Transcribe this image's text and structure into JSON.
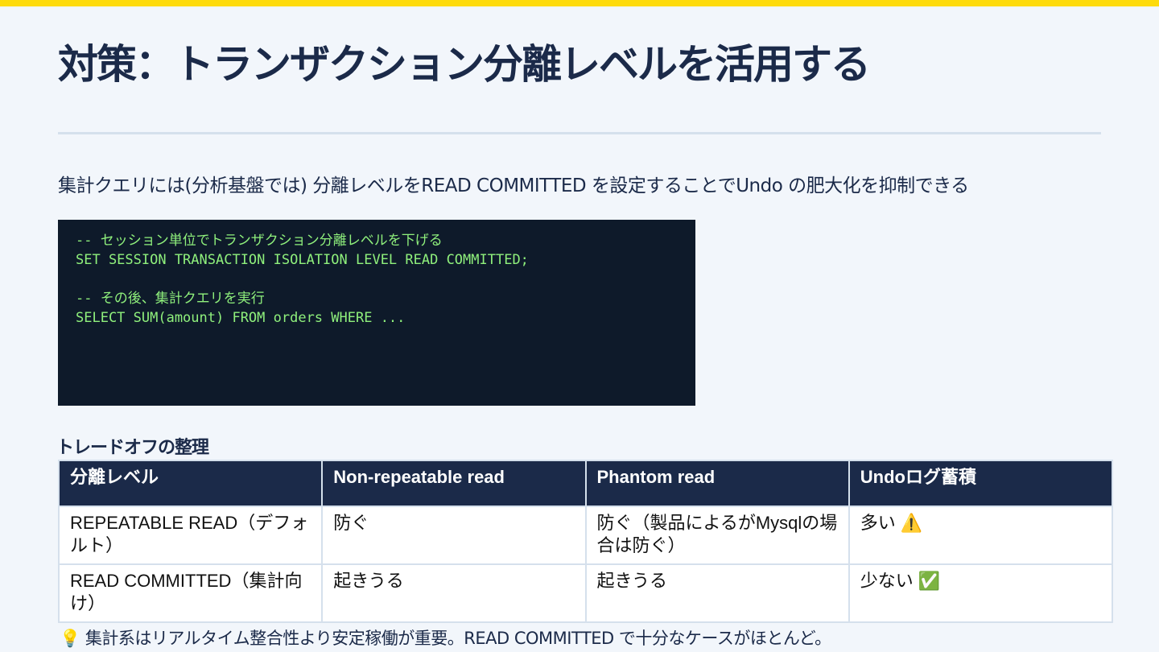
{
  "accent_colors": {
    "top_bar": "#fedb0b",
    "heading": "#1b2a49",
    "code_bg": "#0e1a2a",
    "code_text": "#8ff07c"
  },
  "slide": {
    "title": "対策：トランザクション分離レベルを活用する",
    "lead": "集計クエリには(分析基盤では) 分離レベルをREAD COMMITTED を設定することでUndo の肥大化を抑制できる"
  },
  "code": {
    "lines": [
      "-- セッション単位でトランザクション分離レベルを下げる",
      "SET SESSION TRANSACTION ISOLATION LEVEL READ COMMITTED;",
      "",
      "-- その後、集計クエリを実行",
      "SELECT SUM(amount) FROM orders WHERE ..."
    ]
  },
  "tradeoff": {
    "heading": "トレードオフの整理",
    "headers": [
      "分離レベル",
      "Non-repeatable read",
      "Phantom read",
      "Undoログ蓄積"
    ],
    "rows": [
      [
        "REPEATABLE READ（デフォルト）",
        "防ぐ",
        "防ぐ（製品によるがMysqlの場合は防ぐ）",
        "多い ⚠️"
      ],
      [
        "READ COMMITTED（集計向け）",
        "起きうる",
        "起きうる",
        "少ない ✅"
      ]
    ]
  },
  "footer": {
    "icon": "lightbulb-icon",
    "glyph": "💡",
    "text": "集計系はリアルタイム整合性より安定稼働が重要。READ COMMITTED で十分なケースがほとんど。"
  }
}
